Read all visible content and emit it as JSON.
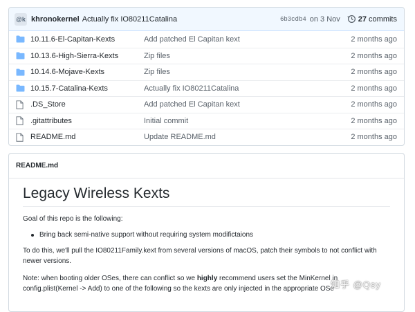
{
  "commit_bar": {
    "avatar_text": "@k",
    "author": "khronokernel",
    "message": "Actually fix IO80211Catalina",
    "sha": "6b3cdb4",
    "date": "on 3 Nov",
    "commit_count": "27",
    "commit_label": "commits"
  },
  "files": [
    {
      "type": "folder",
      "name": "10.11.6-El-Capitan-Kexts",
      "message": "Add patched El Capitan kext",
      "age": "2 months ago"
    },
    {
      "type": "folder",
      "name": "10.13.6-High-Sierra-Kexts",
      "message": "Zip files",
      "age": "2 months ago"
    },
    {
      "type": "folder",
      "name": "10.14.6-Mojave-Kexts",
      "message": "Zip files",
      "age": "2 months ago"
    },
    {
      "type": "folder",
      "name": "10.15.7-Catalina-Kexts",
      "message": "Actually fix IO80211Catalina",
      "age": "2 months ago"
    },
    {
      "type": "file",
      "name": ".DS_Store",
      "message": "Add patched El Capitan kext",
      "age": "2 months ago"
    },
    {
      "type": "file",
      "name": ".gitattributes",
      "message": "Initial commit",
      "age": "2 months ago"
    },
    {
      "type": "file",
      "name": "README.md",
      "message": "Update README.md",
      "age": "2 months ago"
    }
  ],
  "readme": {
    "header": "README.md",
    "title": "Legacy Wireless Kexts",
    "goal": "Goal of this repo is the following:",
    "bullet": "Bring back semi-native support without requiring system modifictaions",
    "para2": "To do this, we'll pull the IO80211Family.kext from several versions of macOS, patch their symbols to not conflict with newer versions.",
    "para3_prefix": "Note: when booting older OSes, there can conflict so we ",
    "para3_bold": "highly",
    "para3_suffix": " recommend users set the MinKernel in ",
    "para4": "config.plist(Kernel -> Add) to one of the following so the kexts are only injected in the appropriate OSe"
  },
  "watermark": "知乎 @Qsy",
  "colors": {
    "folder": "#79b8ff",
    "link": "#0366d6",
    "muted": "#586069",
    "commit_bar_bg": "#f1f8ff"
  }
}
